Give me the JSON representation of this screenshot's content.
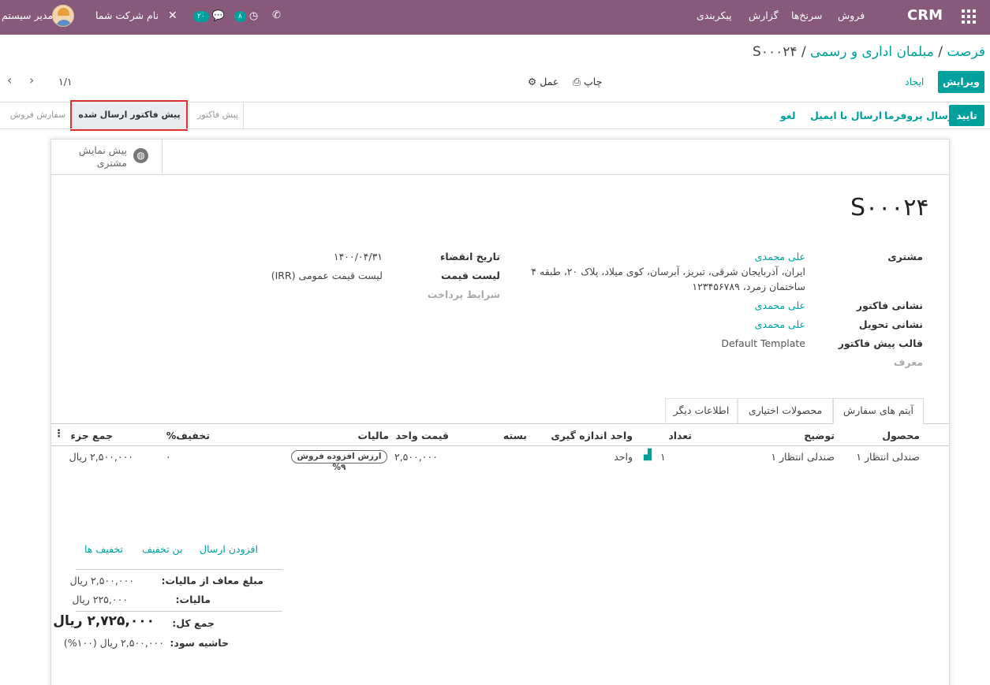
{
  "topbar": {
    "app_name": "CRM",
    "menu": [
      "فروش",
      "سرنخ‌ها",
      "گزارش",
      "پیکربندی"
    ],
    "activity_count": "۸",
    "message_count": "۲۰",
    "company": "نام شرکت شما",
    "user": "مدیر سیستم"
  },
  "breadcrumb": {
    "part1": "فرصت",
    "part2": "مبلمان اداری و رسمی",
    "part3": "S۰۰۰۲۴",
    "sep": "/"
  },
  "controls": {
    "edit": "ویرایش",
    "create": "ایجاد",
    "print": "چاپ",
    "action": "عمل",
    "pager": "۱/۱"
  },
  "statusbar": {
    "confirm": "تایید",
    "send_proforma": "ارسال پروفرما",
    "send_email": "ارسال با ایمیل",
    "cancel": "لغو",
    "stages": [
      "سفارش فروش",
      "پیش فاکتور ارسال شده",
      "پیش فاکتور"
    ],
    "active_stage": "پیش فاکتور ارسال شده"
  },
  "smart_button": {
    "line1": "پیش نمایش",
    "line2": "مشتری"
  },
  "order": {
    "number": "S۰۰۰۲۴",
    "customer_label": "مشتری",
    "customer": "علی محمدی",
    "address1": "ایران، آذربایجان شرقی، تبریز، آبرسان، کوی میلاد، پلاک ۲۰، طبقه ۴",
    "address2": "ساختمان زمرد، ۱۲۳۴۵۶۷۸۹",
    "invoice_addr_label": "نشانی فاکتور",
    "invoice_addr": "علی محمدی",
    "delivery_addr_label": "نشانی تحویل",
    "delivery_addr": "علی محمدی",
    "template_label": "قالب پیش فاکتور",
    "template": "Default Template",
    "referrer_label": "معرف",
    "expiry_label": "تاریخ انقضاء",
    "expiry": "۱۴۰۰/۰۴/۳۱",
    "pricelist_label": "لیست قیمت",
    "pricelist": "لیست قیمت عمومی (IRR)",
    "payment_terms_label": "شرایط پرداخت"
  },
  "tabs": [
    "آیتم های سفارش",
    "محصولات اختیاری",
    "اطلاعات دیگر"
  ],
  "table": {
    "headers": {
      "product": "محصول",
      "description": "توضیح",
      "qty": "تعداد",
      "uom": "واحد اندازه گیری",
      "package": "بسته",
      "unit_price": "قیمت واحد",
      "taxes": "مالیات",
      "discount": "تخفیف%",
      "subtotal": "جمع جزء"
    },
    "row": {
      "product": "صندلی انتظار ۱",
      "description": "صندلی انتظار ۱",
      "qty": "۱",
      "uom": "واحد",
      "unit_price": "۲,۵۰۰,۰۰۰",
      "tax": "ارزش افزوده فروش ۹%",
      "discount": "۰",
      "subtotal": "۲,۵۰۰,۰۰۰ ریال"
    }
  },
  "actions": {
    "add_shipping": "افزودن ارسال",
    "coupon": "بن تخفیف",
    "promotions": "تخفیف ها"
  },
  "totals": {
    "untaxed_label": "مبلغ معاف از مالیات:",
    "untaxed": "۲,۵۰۰,۰۰۰ ریال",
    "taxes_label": "مالیات:",
    "taxes": "۲۲۵,۰۰۰ ریال",
    "total_label": "جمع کل:",
    "total": "۲,۷۲۵,۰۰۰ ریال",
    "margin_label": "حاشیه سود:",
    "margin": "۲,۵۰۰,۰۰۰ ریال (۱۰۰%)"
  },
  "colors": {
    "brand": "#875a7b",
    "accent": "#00a09d",
    "highlight": "#e03131"
  }
}
